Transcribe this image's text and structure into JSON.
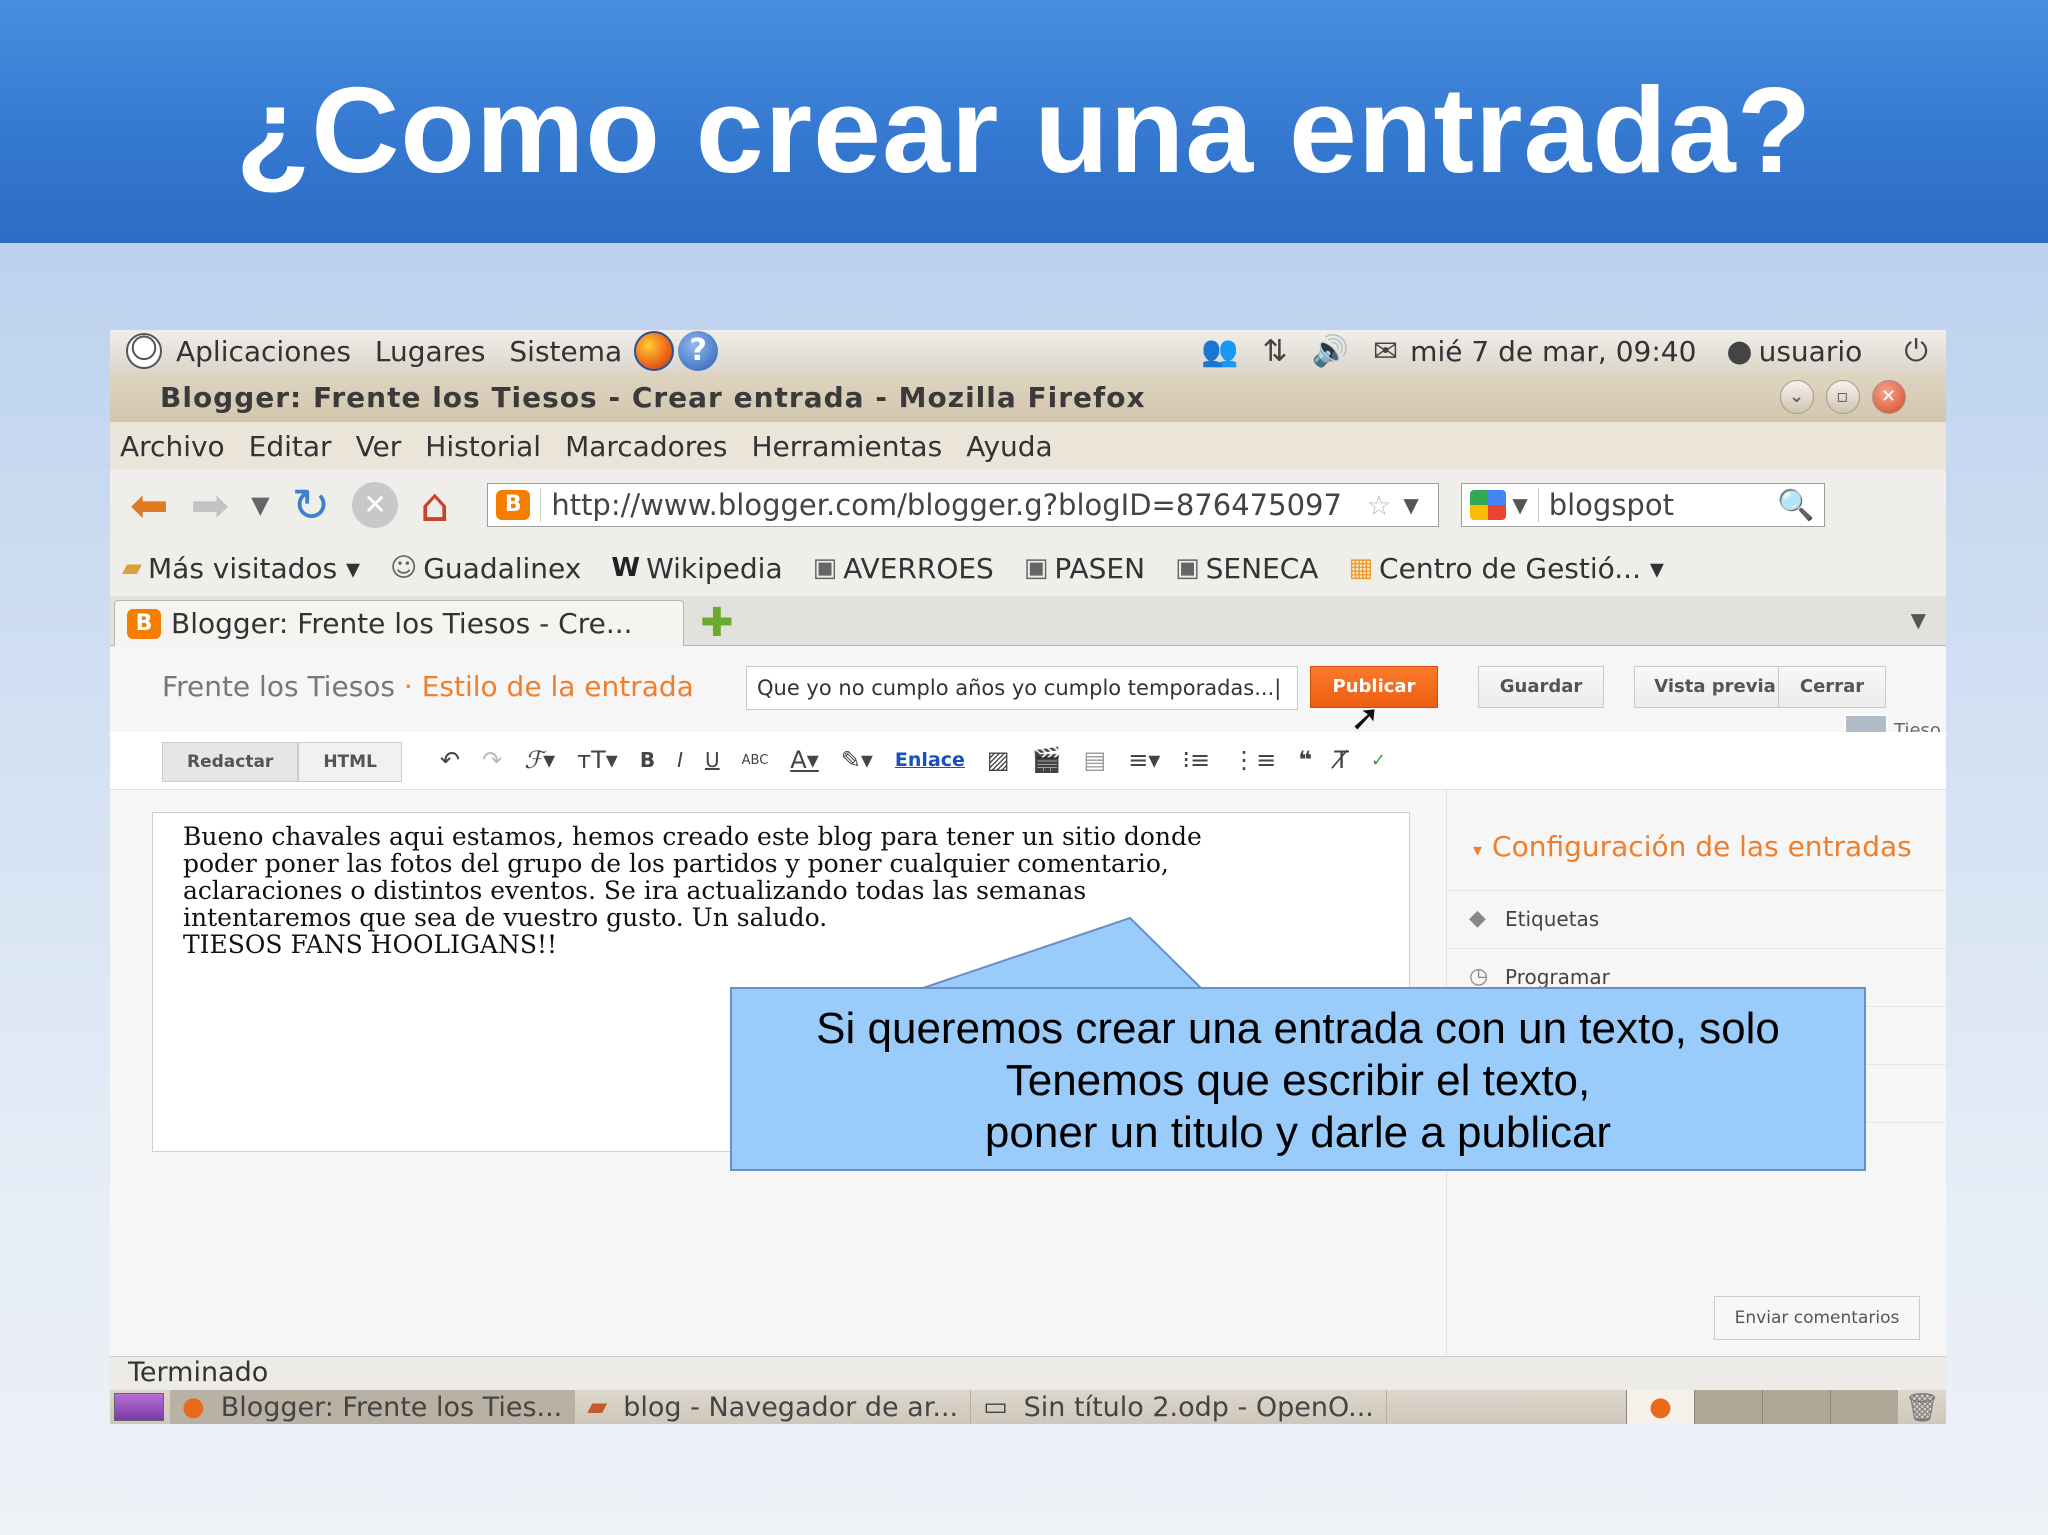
{
  "slide": {
    "title": "¿Como crear una entrada?"
  },
  "gnome_panel": {
    "menus": [
      "Aplicaciones",
      "Lugares",
      "Sistema"
    ],
    "clock": "mié  7 de mar, 09:40",
    "user": "usuario"
  },
  "window": {
    "title": "Blogger: Frente los Tiesos - Crear entrada - Mozilla Firefox"
  },
  "menubar": [
    "Archivo",
    "Editar",
    "Ver",
    "Historial",
    "Marcadores",
    "Herramientas",
    "Ayuda"
  ],
  "navigation": {
    "url": "http://www.blogger.com/blogger.g?blogID=876475097",
    "search_value": "blogspot"
  },
  "bookmarks": [
    "Más visitados ▾",
    "Guadalinex",
    "Wikipedia",
    "AVERROES",
    "PASEN",
    "SENECA",
    "Centro de Gestió... ▾"
  ],
  "tab": {
    "label": "Blogger: Frente los Tiesos - Cre..."
  },
  "blogger": {
    "blog_name": "Frente los Tiesos",
    "separator": " · ",
    "section": "Estilo de la entrada",
    "post_title": "Que yo no cumplo años yo cumplo temporadas...|",
    "buttons": {
      "publish": "Publicar",
      "save": "Guardar",
      "preview": "Vista previa",
      "close": "Cerrar"
    },
    "user_short": "Tieso",
    "modes": [
      "Redactar",
      "HTML"
    ],
    "toolbar_link": "Enlace",
    "body_text": "Bueno chavales aqui estamos, hemos creado este blog para tener un sitio donde\npoder poner las fotos del grupo de los partidos y poner cualquier comentario,\naclaraciones o distintos eventos. Se ira actualizando todas las semanas\nintentaremos que sea de vuestro gusto. Un saludo.\nTIESOS FANS HOOLIGANS!!",
    "sidebar": {
      "heading": "Configuración de las entradas",
      "labels": "Etiquetas",
      "schedule": "Programar"
    },
    "feedback": "Enviar comentarios"
  },
  "status": "Terminado",
  "taskbar": {
    "items": [
      "Blogger: Frente los Ties...",
      "blog - Navegador de ar...",
      "Sin título 2.odp - OpenO..."
    ]
  },
  "callout": {
    "line1": "Si queremos crear una entrada con un texto, solo",
    "line2": "Tenemos que escribir el texto,",
    "line3": "poner un titulo y darle a publicar"
  },
  "colors": {
    "header_blue": "#3579d1",
    "blogger_orange": "#ee7f2d",
    "callout_fill": "#99cbfb"
  }
}
